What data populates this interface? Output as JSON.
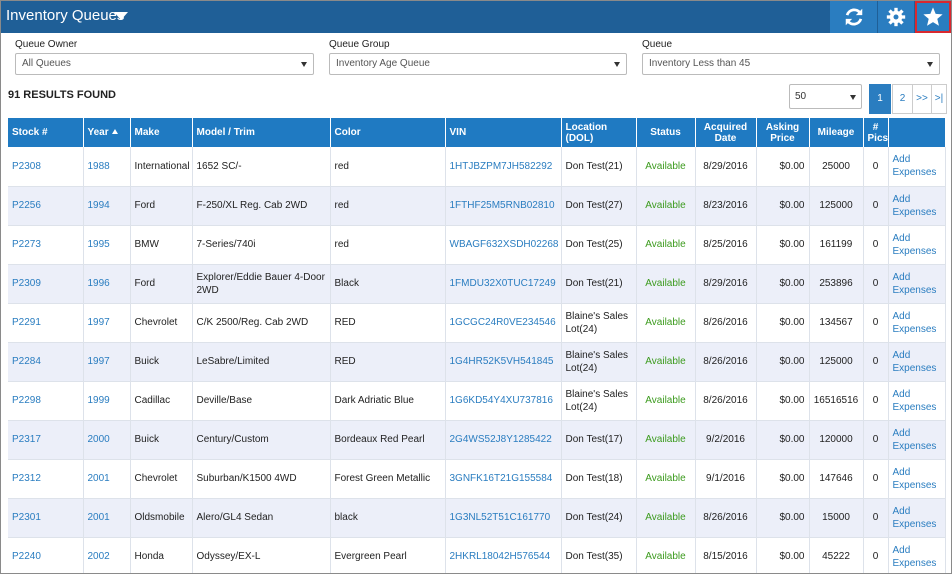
{
  "header": {
    "title": "Inventory Queues"
  },
  "filters": {
    "queue_owner": {
      "label": "Queue Owner",
      "value": "All Queues"
    },
    "queue_group": {
      "label": "Queue Group",
      "value": "Inventory Age Queue"
    },
    "queue": {
      "label": "Queue",
      "value": "Inventory Less than 45"
    }
  },
  "results": {
    "text": "91 RESULTS FOUND",
    "per_page": "50"
  },
  "pagination": {
    "pages": [
      "1",
      "2"
    ],
    "next": ">>",
    "last": ">|",
    "current": "1"
  },
  "table": {
    "columns": [
      "Stock #",
      "Year",
      "Make",
      "Model / Trim",
      "Color",
      "VIN",
      "Location (DOL)",
      "Status",
      "Acquired Date",
      "Asking Price",
      "Mileage",
      "# Pics",
      ""
    ],
    "rows": [
      {
        "stock": "P2308",
        "year": "1988",
        "make": "International",
        "model": "1652 SC/-",
        "color": "red",
        "vin": "1HTJBZPM7JH582292",
        "location": "Don Test(21)",
        "status": "Available",
        "acquired": "8/29/2016",
        "price": "$0.00",
        "mileage": "25000",
        "pics": "0",
        "action": "Add Expenses"
      },
      {
        "stock": "P2256",
        "year": "1994",
        "make": "Ford",
        "model": "F-250/XL Reg. Cab 2WD",
        "color": "red",
        "vin": "1FTHF25M5RNB02810",
        "location": "Don Test(27)",
        "status": "Available",
        "acquired": "8/23/2016",
        "price": "$0.00",
        "mileage": "125000",
        "pics": "0",
        "action": "Add Expenses"
      },
      {
        "stock": "P2273",
        "year": "1995",
        "make": "BMW",
        "model": "7-Series/740i",
        "color": "red",
        "vin": "WBAGF632XSDH02268",
        "location": "Don Test(25)",
        "status": "Available",
        "acquired": "8/25/2016",
        "price": "$0.00",
        "mileage": "161199",
        "pics": "0",
        "action": "Add Expenses"
      },
      {
        "stock": "P2309",
        "year": "1996",
        "make": "Ford",
        "model": "Explorer/Eddie Bauer 4-Door 2WD",
        "color": "Black",
        "vin": "1FMDU32X0TUC17249",
        "location": "Don Test(21)",
        "status": "Available",
        "acquired": "8/29/2016",
        "price": "$0.00",
        "mileage": "253896",
        "pics": "0",
        "action": "Add Expenses"
      },
      {
        "stock": "P2291",
        "year": "1997",
        "make": "Chevrolet",
        "model": "C/K 2500/Reg. Cab 2WD",
        "color": "RED",
        "vin": "1GCGC24R0VE234546",
        "location": "Blaine's Sales Lot(24)",
        "status": "Available",
        "acquired": "8/26/2016",
        "price": "$0.00",
        "mileage": "134567",
        "pics": "0",
        "action": "Add Expenses"
      },
      {
        "stock": "P2284",
        "year": "1997",
        "make": "Buick",
        "model": "LeSabre/Limited",
        "color": "RED",
        "vin": "1G4HR52K5VH541845",
        "location": "Blaine's Sales Lot(24)",
        "status": "Available",
        "acquired": "8/26/2016",
        "price": "$0.00",
        "mileage": "125000",
        "pics": "0",
        "action": "Add Expenses"
      },
      {
        "stock": "P2298",
        "year": "1999",
        "make": "Cadillac",
        "model": "Deville/Base",
        "color": "Dark Adriatic Blue",
        "vin": "1G6KD54Y4XU737816",
        "location": "Blaine's Sales Lot(24)",
        "status": "Available",
        "acquired": "8/26/2016",
        "price": "$0.00",
        "mileage": "16516516",
        "pics": "0",
        "action": "Add Expenses"
      },
      {
        "stock": "P2317",
        "year": "2000",
        "make": "Buick",
        "model": "Century/Custom",
        "color": "Bordeaux Red Pearl",
        "vin": "2G4WS52J8Y1285422",
        "location": "Don Test(17)",
        "status": "Available",
        "acquired": "9/2/2016",
        "price": "$0.00",
        "mileage": "120000",
        "pics": "0",
        "action": "Add Expenses"
      },
      {
        "stock": "P2312",
        "year": "2001",
        "make": "Chevrolet",
        "model": "Suburban/K1500 4WD",
        "color": "Forest Green Metallic",
        "vin": "3GNFK16T21G155584",
        "location": "Don Test(18)",
        "status": "Available",
        "acquired": "9/1/2016",
        "price": "$0.00",
        "mileage": "147646",
        "pics": "0",
        "action": "Add Expenses"
      },
      {
        "stock": "P2301",
        "year": "2001",
        "make": "Oldsmobile",
        "model": "Alero/GL4 Sedan",
        "color": "black",
        "vin": "1G3NL52T51C161770",
        "location": "Don Test(24)",
        "status": "Available",
        "acquired": "8/26/2016",
        "price": "$0.00",
        "mileage": "15000",
        "pics": "0",
        "action": "Add Expenses"
      },
      {
        "stock": "P2240",
        "year": "2002",
        "make": "Honda",
        "model": "Odyssey/EX-L",
        "color": "Evergreen Pearl",
        "vin": "2HKRL18042H576544",
        "location": "Don Test(35)",
        "status": "Available",
        "acquired": "8/15/2016",
        "price": "$0.00",
        "mileage": "45222",
        "pics": "0",
        "action": "Add Expenses"
      }
    ]
  },
  "colors": {
    "header_bg": "#1f5f97",
    "button_bg": "#2a7dc0",
    "table_header": "#1f7ac2",
    "available": "#3c9b1e",
    "link": "#2a7dc0",
    "highlight_border": "#d9282f"
  },
  "icons": {
    "refresh": "refresh-icon",
    "settings": "gear-icon",
    "favorite": "star-icon",
    "dropdown": "chevron-down-icon",
    "sort": "sort-ascending-icon"
  }
}
